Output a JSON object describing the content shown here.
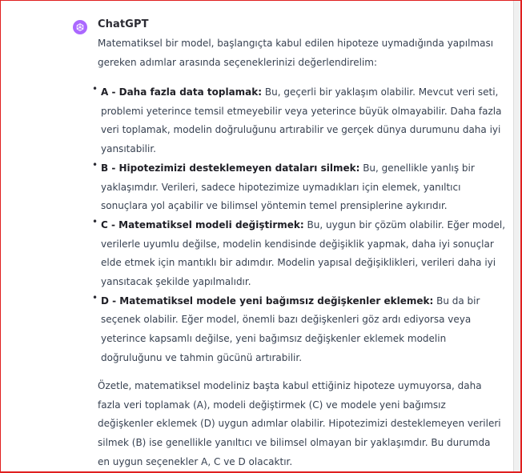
{
  "message": {
    "author": "ChatGPT",
    "avatar_icon": "openai-logo-icon",
    "avatar_color": "#ab68ff",
    "intro": "Matematiksel bir model, başlangıçta kabul edilen hipoteze uymadığında yapılması gereken adımlar arasında seçeneklerinizi değerlendirelim:",
    "options": [
      {
        "title": "A - Daha fazla data toplamak:",
        "body": " Bu, geçerli bir yaklaşım olabilir. Mevcut veri seti, problemi yeterince temsil etmeyebilir veya yeterince büyük olmayabilir. Daha fazla veri toplamak, modelin doğruluğunu artırabilir ve gerçek dünya durumunu daha iyi yansıtabilir."
      },
      {
        "title": "B - Hipotezimizi desteklemeyen dataları silmek:",
        "body": " Bu, genellikle yanlış bir yaklaşımdır. Verileri, sadece hipotezimize uymadıkları için elemek, yanıltıcı sonuçlara yol açabilir ve bilimsel yöntemin temel prensiplerine aykırıdır."
      },
      {
        "title": "C - Matematiksel modeli değiştirmek:",
        "body": " Bu, uygun bir çözüm olabilir. Eğer model, verilerle uyumlu değilse, modelin kendisinde değişiklik yapmak, daha iyi sonuçlar elde etmek için mantıklı bir adımdır. Modelin yapısal değişiklikleri, verileri daha iyi yansıtacak şekilde yapılmalıdır."
      },
      {
        "title": "D - Matematiksel modele yeni bağımsız değişkenler eklemek:",
        "body": " Bu da bir seçenek olabilir. Eğer model, önemli bazı değişkenleri göz ardı ediyorsa veya yeterince kapsamlı değilse, yeni bağımsız değişkenler eklemek modelin doğruluğunu ve tahmin gücünü artırabilir."
      }
    ],
    "summary": "Özetle, matematiksel modeliniz başta kabul ettiğiniz hipoteze uymuyorsa, daha fazla veri toplamak (A), modeli değiştirmek (C) ve modele yeni bağımsız değişkenler eklemek (D) uygun adımlar olabilir. Hipotezimizi desteklemeyen verileri silmek (B) ise genellikle yanıltıcı ve bilimsel olmayan bir yaklaşımdır. Bu durumda en uygun seçenekler A, C ve D olacaktır."
  }
}
